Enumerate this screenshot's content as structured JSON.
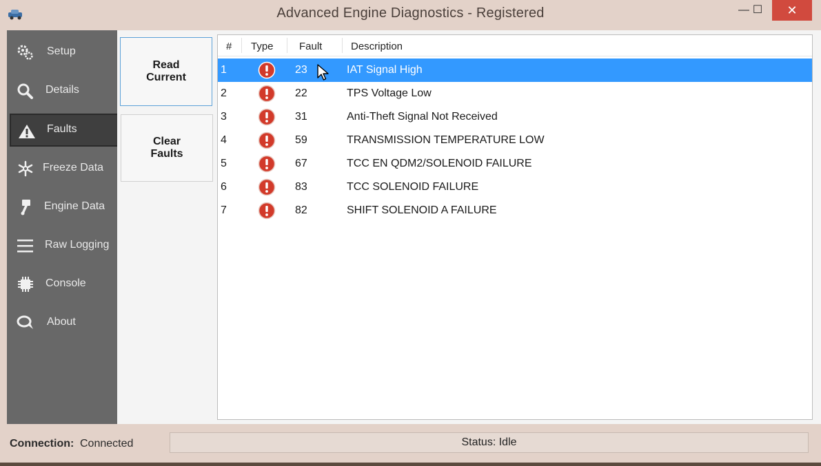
{
  "window": {
    "title": "Advanced Engine Diagnostics - Registered",
    "minimize": "—",
    "maximize": "☐",
    "close": "✕"
  },
  "sidebar": {
    "items": [
      {
        "label": "Setup",
        "icon": "gears-icon"
      },
      {
        "label": "Details",
        "icon": "magnifier-icon"
      },
      {
        "label": "Faults",
        "icon": "warning-icon",
        "active": true
      },
      {
        "label": "Freeze Data",
        "icon": "snowflake-icon"
      },
      {
        "label": "Engine Data",
        "icon": "piston-icon"
      },
      {
        "label": "Raw Logging",
        "icon": "hamburger-icon"
      },
      {
        "label": "Console",
        "icon": "chip-icon"
      },
      {
        "label": "About",
        "icon": "chat-icon"
      }
    ]
  },
  "actions": {
    "read_line1": "Read",
    "read_line2": "Current",
    "clear_line1": "Clear",
    "clear_line2": "Faults"
  },
  "faults": {
    "columns": {
      "num": "#",
      "type": "Type",
      "fault": "Fault",
      "description": "Description"
    },
    "rows": [
      {
        "num": "1",
        "fault": "23",
        "description": "IAT Signal High"
      },
      {
        "num": "2",
        "fault": "22",
        "description": "TPS Voltage Low"
      },
      {
        "num": "3",
        "fault": "31",
        "description": "Anti-Theft Signal Not Received"
      },
      {
        "num": "4",
        "fault": "59",
        "description": "TRANSMISSION TEMPERATURE LOW"
      },
      {
        "num": "5",
        "fault": "67",
        "description": "TCC EN QDM2/SOLENOID FAILURE"
      },
      {
        "num": "6",
        "fault": "83",
        "description": "TCC SOLENOID FAILURE"
      },
      {
        "num": "7",
        "fault": "82",
        "description": "SHIFT SOLENOID A FAILURE"
      }
    ],
    "selected_row": 1
  },
  "footer": {
    "connection_label": "Connection:",
    "connection_value": "Connected",
    "status": "Status: Idle"
  },
  "colors": {
    "selection": "#3399ff",
    "sidebar": "#686868",
    "error_icon": "#d23a2a",
    "close_button": "#d14a3e"
  }
}
